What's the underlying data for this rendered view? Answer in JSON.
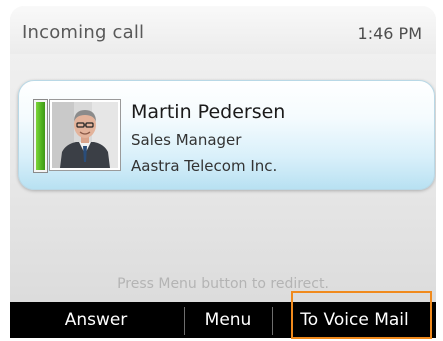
{
  "header": {
    "title": "Incoming call",
    "time": "1:46 PM"
  },
  "caller": {
    "name": "Martin Pedersen",
    "title": "Sales Manager",
    "company": "Aastra Telecom Inc.",
    "photo_icon": "caller-photo-icon"
  },
  "hint": "Press Menu button to redirect.",
  "softkeys": {
    "answer": "Answer",
    "menu": "Menu",
    "voicemail": "To Voice Mail"
  },
  "colors": {
    "highlight": "#f08a1d",
    "card_blue": "#b8e1f2",
    "status_green": "#4fb21f",
    "softkey_bg": "#000000"
  }
}
